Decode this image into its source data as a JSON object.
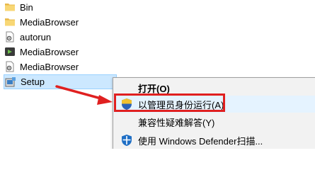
{
  "files": [
    {
      "name": "Bin",
      "icon": "folder-icon"
    },
    {
      "name": "MediaBrowser",
      "icon": "folder-icon"
    },
    {
      "name": "autorun",
      "icon": "settings-file-icon"
    },
    {
      "name": "MediaBrowser",
      "icon": "app-icon"
    },
    {
      "name": "MediaBrowser",
      "icon": "settings-file-icon"
    },
    {
      "name": "Setup",
      "icon": "setup-icon",
      "selected": true
    }
  ],
  "context_menu": {
    "open_label": "打开(O)",
    "run_as_admin_label": "以管理员身份运行(A)",
    "compat_troubleshoot_label": "兼容性疑难解答(Y)",
    "defender_scan_label": "使用 Windows Defender扫描..."
  },
  "colors": {
    "annotation": "#e02020",
    "selection_bg": "#cce8ff",
    "menu_bg": "#f2f2f2"
  }
}
